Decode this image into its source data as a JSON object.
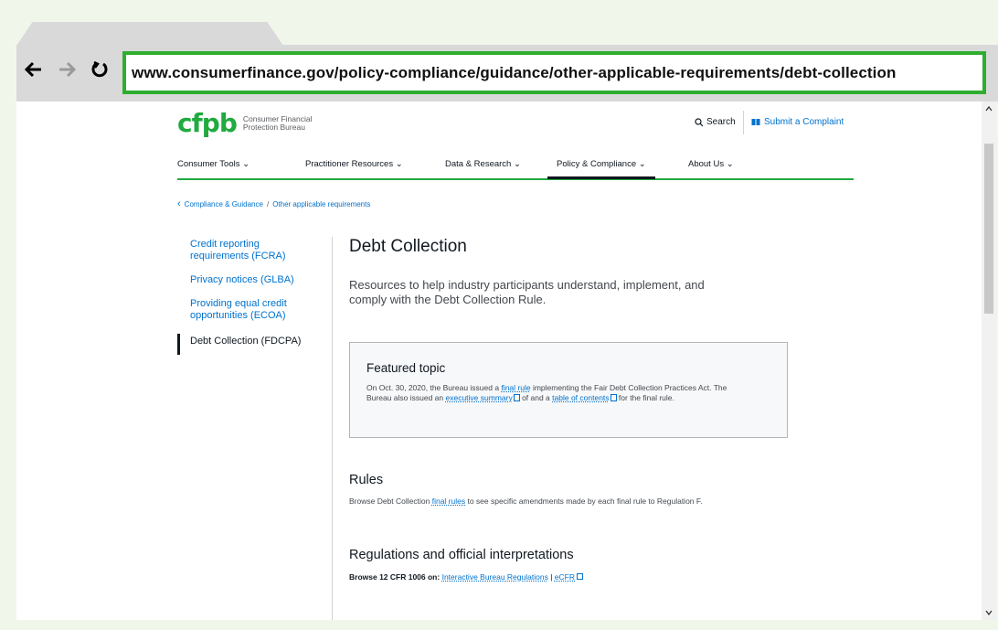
{
  "browser": {
    "url": "www.consumerfinance.gov/policy-compliance/guidance/other-applicable-requirements/debt-collection",
    "back_icon": "arrow-left-icon",
    "forward_icon": "arrow-right-icon",
    "reload_icon": "reload-icon"
  },
  "header": {
    "logo_mark": "cfpb",
    "logo_line1": "Consumer Financial",
    "logo_line2": "Protection Bureau",
    "search_label": "Search",
    "complaint_label": "Submit a Complaint"
  },
  "nav": {
    "items": [
      {
        "label": "Consumer Tools"
      },
      {
        "label": "Practitioner Resources"
      },
      {
        "label": "Data & Research"
      },
      {
        "label": "Policy & Compliance"
      },
      {
        "label": "About Us"
      }
    ]
  },
  "breadcrumb": {
    "items": [
      "Compliance & Guidance",
      "Other applicable requirements"
    ],
    "separator": "/"
  },
  "sidebar": {
    "items": [
      {
        "label": "Credit reporting requirements (FCRA)"
      },
      {
        "label": "Privacy notices (GLBA)"
      },
      {
        "label": "Providing equal credit opportunities (ECOA)"
      },
      {
        "label": "Debt Collection (FDCPA)"
      }
    ]
  },
  "content": {
    "title": "Debt Collection",
    "lead": "Resources to help industry participants understand, implement, and comply with the Debt Collection Rule.",
    "featured": {
      "title": "Featured topic",
      "text1": "On Oct. 30, 2020, the Bureau issued a ",
      "link1": "final rule",
      "text2": " implementing the Fair Debt Collection Practices Act. The Bureau also issued an ",
      "link2": "executive summary",
      "text3": " of and a ",
      "link3": "table of contents",
      "text4": " for the final rule."
    },
    "rules": {
      "title": "Rules",
      "text1": "Browse Debt Collection ",
      "link": "final rules",
      "text2": " to see specific amendments made by each final rule to Regulation F."
    },
    "regs": {
      "title": "Regulations and official interpretations",
      "prefix": "Browse 12 CFR 1006 on:",
      "link1": "Interactive Bureau Regulations",
      "sep": "|",
      "link2": "eCFR"
    }
  },
  "colors": {
    "brand_green": "#20aa3f",
    "link_blue": "#0072ce",
    "url_border": "#2fad2f"
  }
}
